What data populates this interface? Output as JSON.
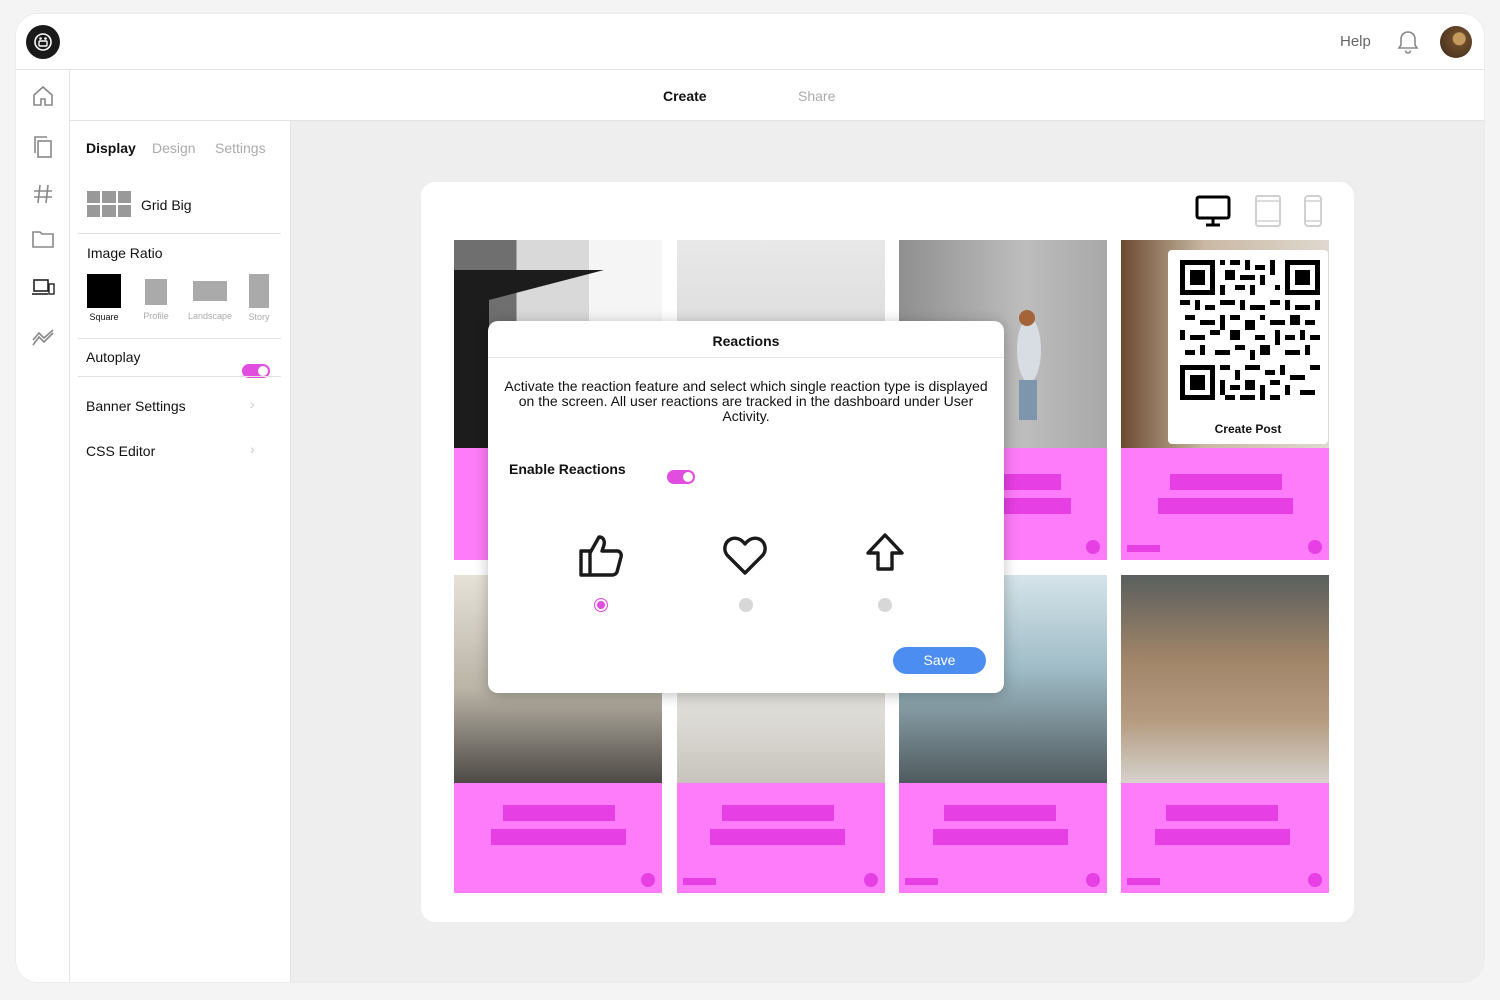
{
  "header": {
    "help_label": "Help"
  },
  "nav_tabs": {
    "create": "Create",
    "share": "Share"
  },
  "rail": {
    "icons": [
      "home-icon",
      "copy-icon",
      "hashtag-icon",
      "folder-icon",
      "devices-icon",
      "analytics-icon"
    ]
  },
  "panel": {
    "tabs": {
      "display": "Display",
      "design": "Design",
      "settings": "Settings"
    },
    "layout_label": "Grid Big",
    "image_ratio_title": "Image Ratio",
    "ratios": {
      "square": "Square",
      "profile": "Profile",
      "landscape": "Landscape",
      "story": "Story"
    },
    "selected_ratio": "Square",
    "autoplay_label": "Autoplay",
    "autoplay_on": true,
    "banner_settings_label": "Banner Settings",
    "css_editor_label": "CSS Editor"
  },
  "preview": {
    "device_options": [
      "desktop-icon",
      "tablet-icon",
      "mobile-icon"
    ],
    "selected_device": "desktop",
    "qr_label": "Create Post"
  },
  "modal": {
    "title": "Reactions",
    "description": "Activate the reaction feature and select which single reaction type is displayed on the screen. All user reactions are tracked in the dashboard under User Activity.",
    "enable_label": "Enable Reactions",
    "enabled": true,
    "reactions": [
      "thumbs-up-icon",
      "heart-icon",
      "arrow-up-icon"
    ],
    "selected_reaction": "thumbs-up",
    "save_label": "Save"
  },
  "colors": {
    "accent": "#e14ddf",
    "card": "#fe7cf9",
    "card_bar": "#e63fe3",
    "save": "#4b8df0"
  }
}
